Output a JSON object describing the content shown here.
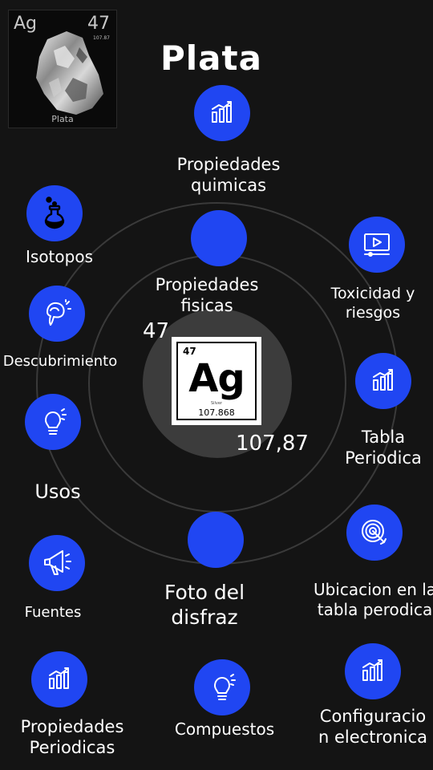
{
  "header": {
    "title": "Plata",
    "thumbnail": {
      "symbol": "Ag",
      "number": "47",
      "mass": "107.87",
      "name": "Plata"
    }
  },
  "center": {
    "atomic_number": "47",
    "atomic_mass": "107,87",
    "card": {
      "number": "47",
      "symbol": "Ag",
      "name": "Silver",
      "mass": "107.868"
    }
  },
  "topics": {
    "propiedades_quimicas": [
      "Propiedades",
      "quimicas"
    ],
    "isotopos": [
      "Isotopos"
    ],
    "toxicidad": [
      "Toxicidad y",
      "riesgos"
    ],
    "propiedades_fisicas": [
      "Propiedades",
      "fisicas"
    ],
    "descubrimiento": [
      "Descubrimiento"
    ],
    "tabla_periodica": [
      "Tabla",
      "Periodica"
    ],
    "usos": [
      "Usos"
    ],
    "ubicacion": [
      "Ubicacion en la",
      "tabla perodica"
    ],
    "foto": [
      "Foto del",
      "disfraz"
    ],
    "fuentes": [
      "Fuentes"
    ],
    "propiedades_periodicas": [
      "Propiedades",
      "Periodicas"
    ],
    "compuestos": [
      "Compuestos"
    ],
    "configuracion": [
      "Configuracio",
      "n electronica"
    ]
  },
  "colors": {
    "accent": "#2046f2",
    "background": "#141414",
    "ring": "#3a3a3a",
    "core": "#3c3c3c"
  },
  "icons": {
    "chart": "bar-chart-icon",
    "flask": "flask-icon",
    "video": "video-icon",
    "idea": "idea-icon",
    "bulb": "lightbulb-icon",
    "target": "target-icon",
    "megaphone": "megaphone-icon"
  }
}
